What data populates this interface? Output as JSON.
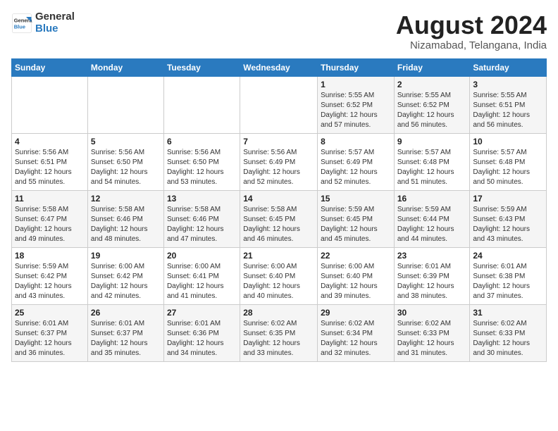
{
  "header": {
    "logo_general": "General",
    "logo_blue": "Blue",
    "title": "August 2024",
    "location": "Nizamabad, Telangana, India"
  },
  "days_of_week": [
    "Sunday",
    "Monday",
    "Tuesday",
    "Wednesday",
    "Thursday",
    "Friday",
    "Saturday"
  ],
  "weeks": [
    [
      {
        "num": "",
        "info": ""
      },
      {
        "num": "",
        "info": ""
      },
      {
        "num": "",
        "info": ""
      },
      {
        "num": "",
        "info": ""
      },
      {
        "num": "1",
        "info": "Sunrise: 5:55 AM\nSunset: 6:52 PM\nDaylight: 12 hours\nand 57 minutes."
      },
      {
        "num": "2",
        "info": "Sunrise: 5:55 AM\nSunset: 6:52 PM\nDaylight: 12 hours\nand 56 minutes."
      },
      {
        "num": "3",
        "info": "Sunrise: 5:55 AM\nSunset: 6:51 PM\nDaylight: 12 hours\nand 56 minutes."
      }
    ],
    [
      {
        "num": "4",
        "info": "Sunrise: 5:56 AM\nSunset: 6:51 PM\nDaylight: 12 hours\nand 55 minutes."
      },
      {
        "num": "5",
        "info": "Sunrise: 5:56 AM\nSunset: 6:50 PM\nDaylight: 12 hours\nand 54 minutes."
      },
      {
        "num": "6",
        "info": "Sunrise: 5:56 AM\nSunset: 6:50 PM\nDaylight: 12 hours\nand 53 minutes."
      },
      {
        "num": "7",
        "info": "Sunrise: 5:56 AM\nSunset: 6:49 PM\nDaylight: 12 hours\nand 52 minutes."
      },
      {
        "num": "8",
        "info": "Sunrise: 5:57 AM\nSunset: 6:49 PM\nDaylight: 12 hours\nand 52 minutes."
      },
      {
        "num": "9",
        "info": "Sunrise: 5:57 AM\nSunset: 6:48 PM\nDaylight: 12 hours\nand 51 minutes."
      },
      {
        "num": "10",
        "info": "Sunrise: 5:57 AM\nSunset: 6:48 PM\nDaylight: 12 hours\nand 50 minutes."
      }
    ],
    [
      {
        "num": "11",
        "info": "Sunrise: 5:58 AM\nSunset: 6:47 PM\nDaylight: 12 hours\nand 49 minutes."
      },
      {
        "num": "12",
        "info": "Sunrise: 5:58 AM\nSunset: 6:46 PM\nDaylight: 12 hours\nand 48 minutes."
      },
      {
        "num": "13",
        "info": "Sunrise: 5:58 AM\nSunset: 6:46 PM\nDaylight: 12 hours\nand 47 minutes."
      },
      {
        "num": "14",
        "info": "Sunrise: 5:58 AM\nSunset: 6:45 PM\nDaylight: 12 hours\nand 46 minutes."
      },
      {
        "num": "15",
        "info": "Sunrise: 5:59 AM\nSunset: 6:45 PM\nDaylight: 12 hours\nand 45 minutes."
      },
      {
        "num": "16",
        "info": "Sunrise: 5:59 AM\nSunset: 6:44 PM\nDaylight: 12 hours\nand 44 minutes."
      },
      {
        "num": "17",
        "info": "Sunrise: 5:59 AM\nSunset: 6:43 PM\nDaylight: 12 hours\nand 43 minutes."
      }
    ],
    [
      {
        "num": "18",
        "info": "Sunrise: 5:59 AM\nSunset: 6:42 PM\nDaylight: 12 hours\nand 43 minutes."
      },
      {
        "num": "19",
        "info": "Sunrise: 6:00 AM\nSunset: 6:42 PM\nDaylight: 12 hours\nand 42 minutes."
      },
      {
        "num": "20",
        "info": "Sunrise: 6:00 AM\nSunset: 6:41 PM\nDaylight: 12 hours\nand 41 minutes."
      },
      {
        "num": "21",
        "info": "Sunrise: 6:00 AM\nSunset: 6:40 PM\nDaylight: 12 hours\nand 40 minutes."
      },
      {
        "num": "22",
        "info": "Sunrise: 6:00 AM\nSunset: 6:40 PM\nDaylight: 12 hours\nand 39 minutes."
      },
      {
        "num": "23",
        "info": "Sunrise: 6:01 AM\nSunset: 6:39 PM\nDaylight: 12 hours\nand 38 minutes."
      },
      {
        "num": "24",
        "info": "Sunrise: 6:01 AM\nSunset: 6:38 PM\nDaylight: 12 hours\nand 37 minutes."
      }
    ],
    [
      {
        "num": "25",
        "info": "Sunrise: 6:01 AM\nSunset: 6:37 PM\nDaylight: 12 hours\nand 36 minutes."
      },
      {
        "num": "26",
        "info": "Sunrise: 6:01 AM\nSunset: 6:37 PM\nDaylight: 12 hours\nand 35 minutes."
      },
      {
        "num": "27",
        "info": "Sunrise: 6:01 AM\nSunset: 6:36 PM\nDaylight: 12 hours\nand 34 minutes."
      },
      {
        "num": "28",
        "info": "Sunrise: 6:02 AM\nSunset: 6:35 PM\nDaylight: 12 hours\nand 33 minutes."
      },
      {
        "num": "29",
        "info": "Sunrise: 6:02 AM\nSunset: 6:34 PM\nDaylight: 12 hours\nand 32 minutes."
      },
      {
        "num": "30",
        "info": "Sunrise: 6:02 AM\nSunset: 6:33 PM\nDaylight: 12 hours\nand 31 minutes."
      },
      {
        "num": "31",
        "info": "Sunrise: 6:02 AM\nSunset: 6:33 PM\nDaylight: 12 hours\nand 30 minutes."
      }
    ]
  ]
}
